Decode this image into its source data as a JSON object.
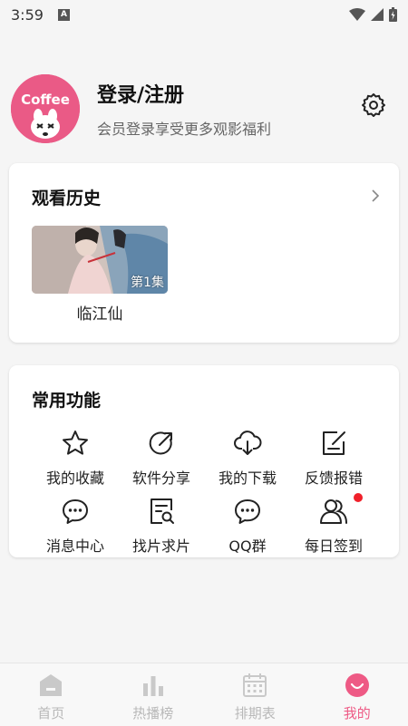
{
  "status_bar": {
    "time": "3:59",
    "notif": "A"
  },
  "profile": {
    "avatar_text": "Coffee",
    "title": "登录/注册",
    "subtitle": "会员登录享受更多观影福利"
  },
  "history": {
    "title": "观看历史",
    "items": [
      {
        "name": "临江仙",
        "episode": "第1集"
      }
    ]
  },
  "tools": {
    "title": "常用功能",
    "items": [
      {
        "label": "我的收藏",
        "icon": "star-icon"
      },
      {
        "label": "软件分享",
        "icon": "share-icon"
      },
      {
        "label": "我的下载",
        "icon": "cloud-download-icon"
      },
      {
        "label": "反馈报错",
        "icon": "edit-note-icon"
      },
      {
        "label": "消息中心",
        "icon": "chat-bubble-icon"
      },
      {
        "label": "找片求片",
        "icon": "document-search-icon"
      },
      {
        "label": "QQ群",
        "icon": "chat-bubble-icon"
      },
      {
        "label": "每日签到",
        "icon": "users-icon"
      }
    ]
  },
  "nav": {
    "items": [
      {
        "label": "首页",
        "icon": "home-icon"
      },
      {
        "label": "热播榜",
        "icon": "bar-chart-icon"
      },
      {
        "label": "排期表",
        "icon": "calendar-icon"
      },
      {
        "label": "我的",
        "icon": "smile-icon"
      }
    ],
    "active_index": 3
  },
  "colors": {
    "accent": "#ee5a85",
    "avatar_bg": "#ea5a86",
    "badge": "#f0202a"
  }
}
